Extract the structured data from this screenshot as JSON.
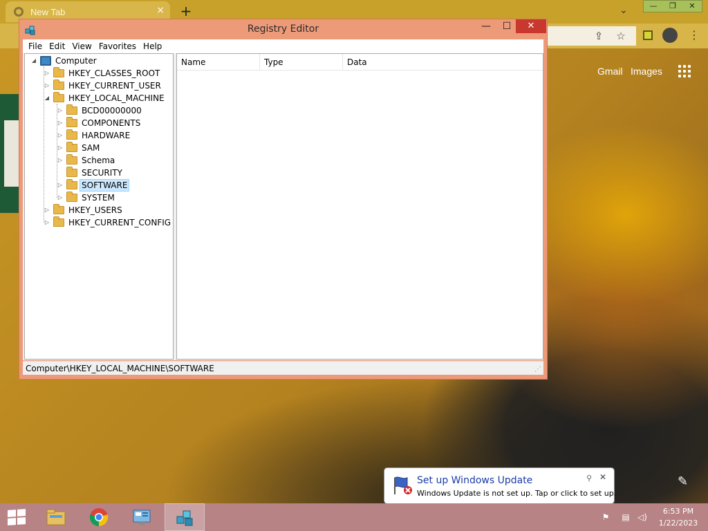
{
  "browser": {
    "tab_title": "New Tab",
    "tab_close": "×",
    "new_tab": "+",
    "links": {
      "gmail": "Gmail",
      "images": "Images"
    }
  },
  "regedit": {
    "title": "Registry Editor",
    "controls": {
      "minimize": "—",
      "maximize": "☐",
      "close": "✕"
    },
    "menu": [
      "File",
      "Edit",
      "View",
      "Favorites",
      "Help"
    ],
    "tree": {
      "root": "Computer",
      "hives": [
        "HKEY_CLASSES_ROOT",
        "HKEY_CURRENT_USER",
        "HKEY_LOCAL_MACHINE",
        "HKEY_USERS",
        "HKEY_CURRENT_CONFIG"
      ],
      "hklm_children": [
        "BCD00000000",
        "COMPONENTS",
        "HARDWARE",
        "SAM",
        "Schema",
        "SECURITY",
        "SOFTWARE",
        "SYSTEM"
      ],
      "selected": "SOFTWARE"
    },
    "columns": [
      "Name",
      "Type",
      "Data"
    ],
    "status_path": "Computer\\HKEY_LOCAL_MACHINE\\SOFTWARE"
  },
  "notification": {
    "title": "Set up Windows Update",
    "message": "Windows Update is not set up. Tap or click to set up."
  },
  "taskbar": {
    "time": "6:53 PM",
    "date": "1/22/2023",
    "apps": [
      "File Explorer",
      "Google Chrome",
      "Control Panel",
      "Registry Editor"
    ],
    "active_app": "Registry Editor"
  },
  "colors": {
    "window_frame": "#ed9a79",
    "close_button": "#c8382e",
    "selection": "#cce8ff",
    "notification_title": "#1a3ba7",
    "taskbar": "#b88384"
  }
}
